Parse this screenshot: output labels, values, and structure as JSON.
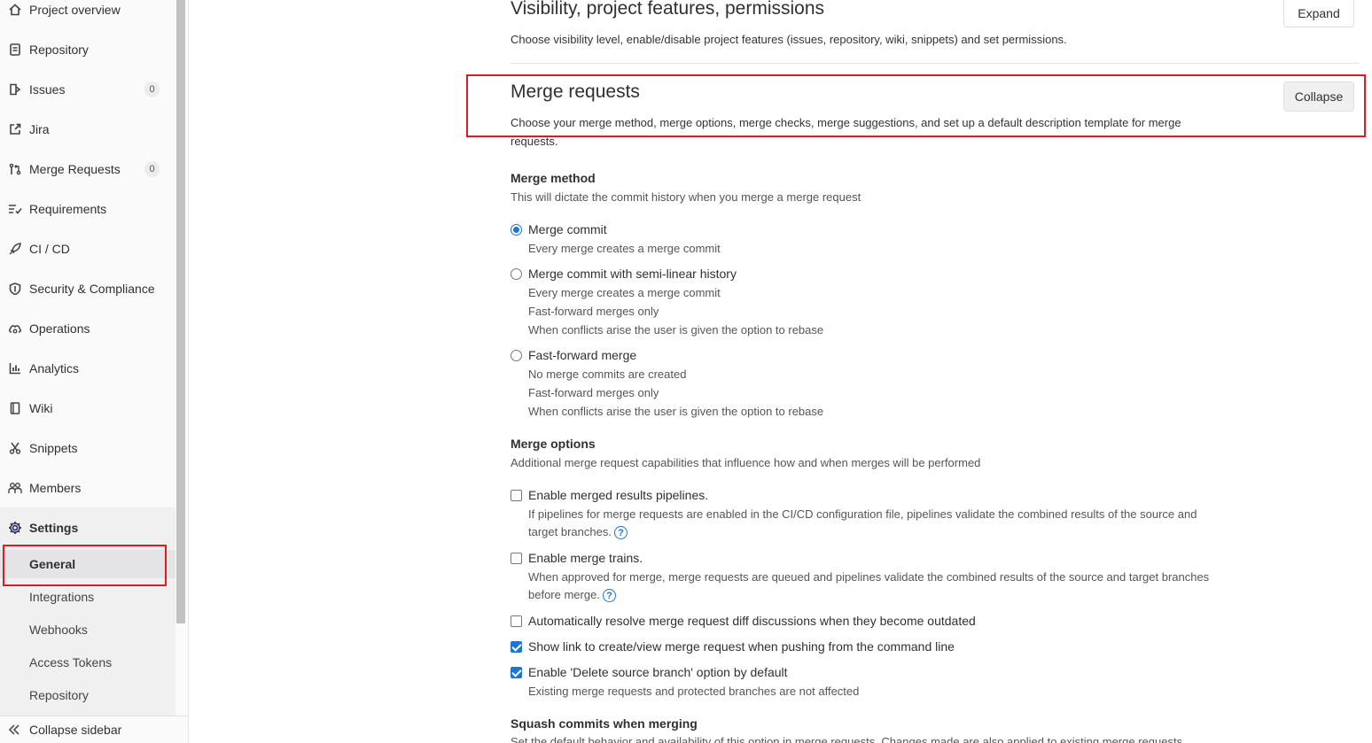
{
  "sidebar": {
    "items": [
      {
        "label": "Project overview",
        "icon": "home-icon"
      },
      {
        "label": "Repository",
        "icon": "document-icon"
      },
      {
        "label": "Issues",
        "icon": "issues-icon",
        "count": "0"
      },
      {
        "label": "Jira",
        "icon": "external-link-icon"
      },
      {
        "label": "Merge Requests",
        "icon": "merge-request-icon",
        "count": "0"
      },
      {
        "label": "Requirements",
        "icon": "requirements-icon"
      },
      {
        "label": "CI / CD",
        "icon": "rocket-icon"
      },
      {
        "label": "Security & Compliance",
        "icon": "shield-icon"
      },
      {
        "label": "Operations",
        "icon": "cloud-gear-icon"
      },
      {
        "label": "Analytics",
        "icon": "chart-icon"
      },
      {
        "label": "Wiki",
        "icon": "book-icon"
      },
      {
        "label": "Snippets",
        "icon": "scissors-icon"
      },
      {
        "label": "Members",
        "icon": "users-icon"
      },
      {
        "label": "Settings",
        "icon": "gear-icon"
      }
    ],
    "settings_sub": [
      "General",
      "Integrations",
      "Webhooks",
      "Access Tokens",
      "Repository"
    ],
    "collapse_label": "Collapse sidebar"
  },
  "visibility": {
    "title": "Visibility, project features, permissions",
    "description": "Choose visibility level, enable/disable project features (issues, repository, wiki, snippets) and set permissions.",
    "button": "Expand"
  },
  "merge_requests": {
    "title": "Merge requests",
    "description": "Choose your merge method, merge options, merge checks, merge suggestions, and set up a default description template for merge",
    "description_cont": "requests.",
    "button": "Collapse"
  },
  "merge_method": {
    "title": "Merge method",
    "help": "This will dictate the commit history when you merge a merge request",
    "options": [
      {
        "label": "Merge commit",
        "checked": true,
        "help": [
          "Every merge creates a merge commit"
        ]
      },
      {
        "label": "Merge commit with semi-linear history",
        "checked": false,
        "help": [
          "Every merge creates a merge commit",
          "Fast-forward merges only",
          "When conflicts arise the user is given the option to rebase"
        ]
      },
      {
        "label": "Fast-forward merge",
        "checked": false,
        "help": [
          "No merge commits are created",
          "Fast-forward merges only",
          "When conflicts arise the user is given the option to rebase"
        ]
      }
    ]
  },
  "merge_options": {
    "title": "Merge options",
    "help": "Additional merge request capabilities that influence how and when merges will be performed",
    "options": [
      {
        "label": "Enable merged results pipelines.",
        "checked": false,
        "help": [
          "If pipelines for merge requests are enabled in the CI/CD configuration file, pipelines validate the combined results of the source and",
          "target branches."
        ]
      },
      {
        "label": "Enable merge trains.",
        "checked": false,
        "help": [
          "When approved for merge, merge requests are queued and pipelines validate the combined results of the source and target branches",
          "before merge."
        ]
      },
      {
        "label": "Automatically resolve merge request diff discussions when they become outdated",
        "checked": false
      },
      {
        "label": "Show link to create/view merge request when pushing from the command line",
        "checked": true
      },
      {
        "label": "Enable 'Delete source branch' option by default",
        "checked": true,
        "help": [
          "Existing merge requests and protected branches are not affected"
        ]
      }
    ]
  },
  "squash": {
    "title": "Squash commits when merging",
    "help": "Set the default behavior and availability of this option in merge requests. Changes made are also applied to existing merge requests."
  },
  "colors": {
    "accent": "#1f75cb",
    "highlight_box": "#e01a22"
  }
}
